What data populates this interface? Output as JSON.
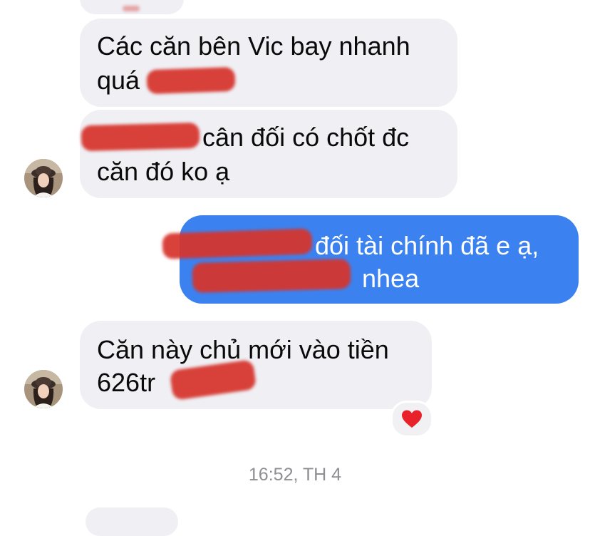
{
  "messages": [
    {
      "text_line1": "Các căn bên Vic bay nhanh",
      "text_line2": "quá"
    },
    {
      "text_line1": "cân đối có chốt đc",
      "text_line2": "căn đó ko ạ"
    },
    {
      "text_line1": "đối tài chính đã e ạ,",
      "text_line2": "nhea"
    },
    {
      "text_line1": "Căn này chủ mới vào tiền",
      "text_line2": "626tr"
    }
  ],
  "reaction": {
    "icon": "heart-icon",
    "color": "#e8222a"
  },
  "timestamp": "16:52, TH 4"
}
